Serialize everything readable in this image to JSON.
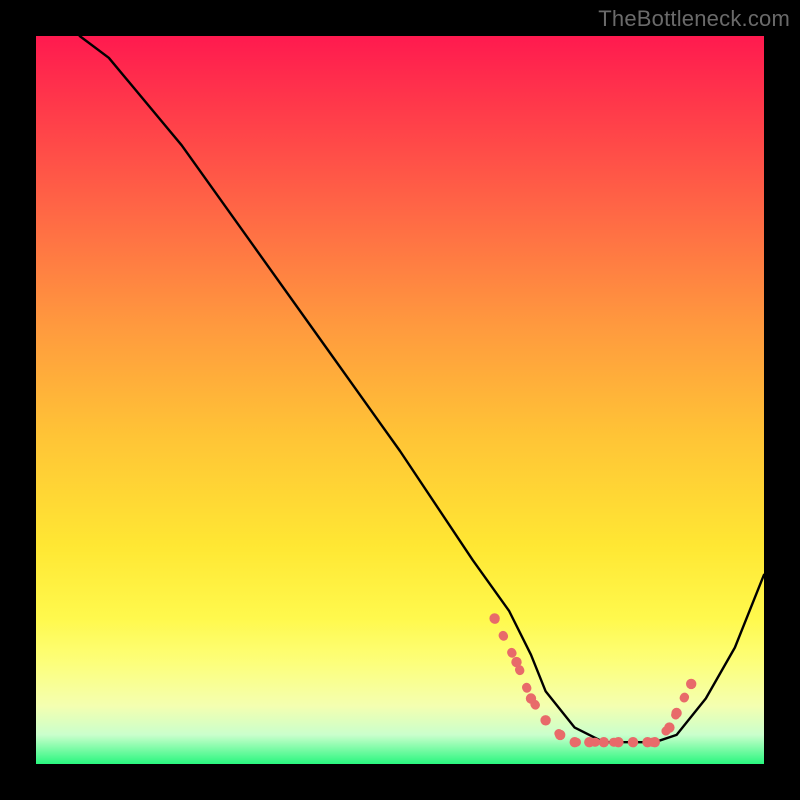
{
  "watermark": "TheBottleneck.com",
  "chart_data": {
    "type": "line",
    "title": "",
    "xlabel": "",
    "ylabel": "",
    "xlim": [
      0,
      100
    ],
    "ylim": [
      0,
      100
    ],
    "grid": false,
    "legend": false,
    "background": "rainbow-gradient",
    "series": [
      {
        "name": "bottleneck-curve",
        "color": "#000000",
        "x": [
          6,
          10,
          20,
          30,
          40,
          50,
          60,
          65,
          68,
          70,
          74,
          78,
          82,
          85,
          88,
          92,
          96,
          100
        ],
        "values": [
          100,
          97,
          85,
          71,
          57,
          43,
          28,
          21,
          15,
          10,
          5,
          3,
          3,
          3,
          4,
          9,
          16,
          26
        ]
      }
    ],
    "dotted_band": {
      "name": "optimal-range-band",
      "color": "#e86a6a",
      "x": [
        63,
        66,
        68,
        70,
        72,
        74,
        76,
        78,
        80,
        82,
        84,
        85,
        87,
        88,
        90
      ],
      "values": [
        20,
        14,
        9,
        6,
        4,
        3,
        3,
        3,
        3,
        3,
        3,
        3,
        5,
        7,
        11
      ]
    }
  }
}
